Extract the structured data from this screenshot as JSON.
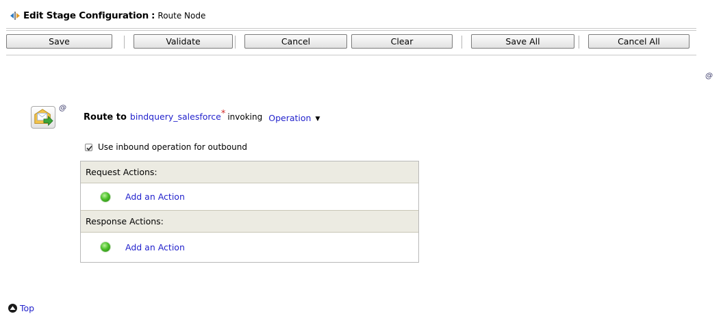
{
  "header": {
    "title": "Edit Stage Configuration",
    "separator": ":",
    "subtitle": "Route Node"
  },
  "toolbar": {
    "save": "Save",
    "validate": "Validate",
    "cancel": "Cancel",
    "clear": "Clear",
    "save_all": "Save All",
    "cancel_all": "Cancel All"
  },
  "annotation_marker": "@",
  "route": {
    "prefix": "Route to",
    "service": "bindquery_salesforce",
    "required_marker": "*",
    "invoking": "invoking",
    "operation": "Operation",
    "operation_arrow": "▼"
  },
  "inbound_option": {
    "label": "Use inbound operation for outbound",
    "checked": true
  },
  "request": {
    "header": "Request Actions:",
    "add_action": "Add an Action"
  },
  "response": {
    "header": "Response Actions:",
    "add_action": "Add an Action"
  },
  "footer": {
    "top_link": "Top"
  },
  "colors": {
    "link": "#2222cc",
    "section_header_bg": "#ecebe2",
    "status_green": "#4cc02a"
  }
}
